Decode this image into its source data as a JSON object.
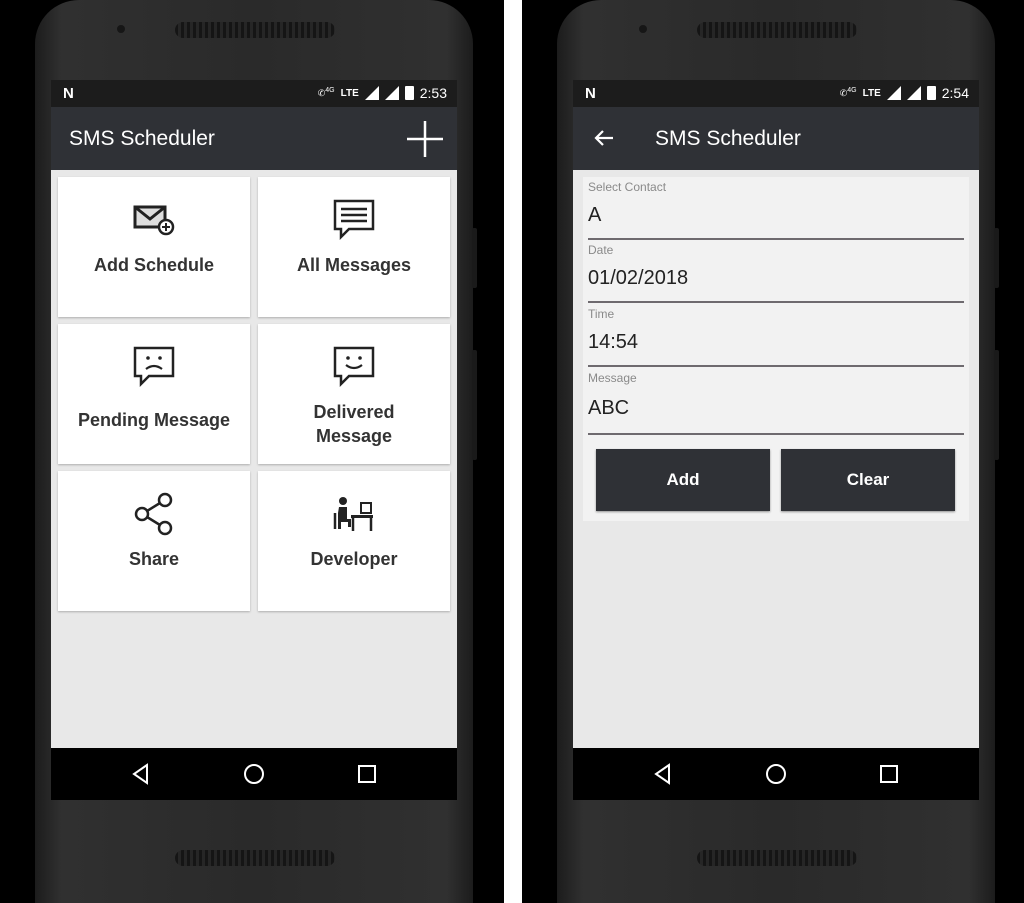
{
  "left_phone": {
    "status": {
      "carrier_glyph": "N",
      "network": "LTE",
      "network_sub": "4G",
      "time": "2:53"
    },
    "appbar": {
      "title": "SMS Scheduler",
      "action_icon": "plus-icon"
    },
    "tiles": [
      {
        "label": "Add Schedule",
        "icon": "mail-add-icon"
      },
      {
        "label": "All Messages",
        "icon": "message-lines-icon"
      },
      {
        "label": "Pending Message",
        "icon": "message-sad-icon"
      },
      {
        "label": "Delivered Message",
        "icon": "message-smile-icon"
      },
      {
        "label": "Share",
        "icon": "share-icon"
      },
      {
        "label": "Developer",
        "icon": "developer-desk-icon"
      }
    ]
  },
  "right_phone": {
    "status": {
      "carrier_glyph": "N",
      "network": "LTE",
      "network_sub": "4G",
      "time": "2:54"
    },
    "appbar": {
      "title": "SMS Scheduler",
      "nav_icon": "back-arrow-icon"
    },
    "form": {
      "fields": [
        {
          "label": "Select Contact",
          "value": "A"
        },
        {
          "label": "Date",
          "value": "01/02/2018"
        },
        {
          "label": "Time",
          "value": "14:54"
        },
        {
          "label": "Message",
          "value": "ABC"
        }
      ],
      "add_label": "Add",
      "clear_label": "Clear"
    }
  },
  "navbar": {
    "icons": [
      "back-triangle-icon",
      "home-circle-icon",
      "recents-square-icon"
    ]
  }
}
